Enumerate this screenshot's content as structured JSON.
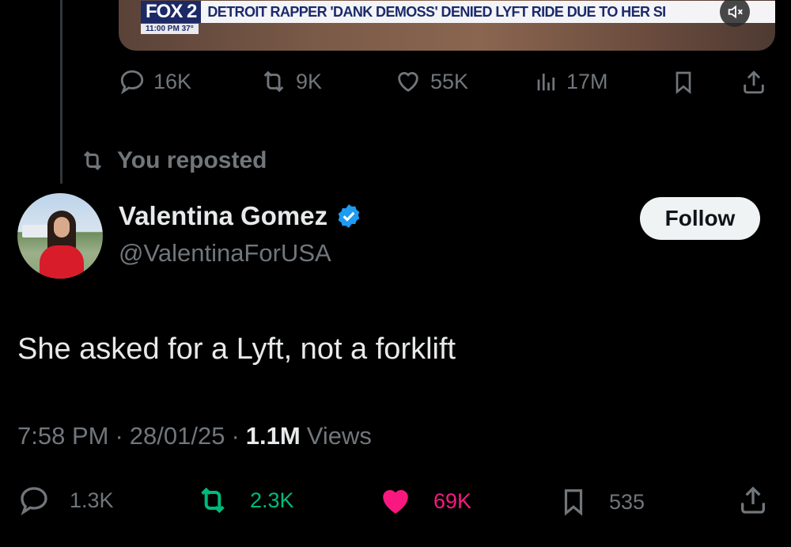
{
  "media": {
    "channel_logo": "FOX 2",
    "headline": "DETROIT RAPPER 'DANK DEMOSS' DENIED LYFT RIDE DUE TO HER SI",
    "time_temp": "11:00 PM  37°",
    "mute_icon": "speaker-muted-icon"
  },
  "previous_tweet": {
    "replies": "16K",
    "reposts": "9K",
    "likes": "55K",
    "views": "17M"
  },
  "repost_banner": "You reposted",
  "author": {
    "display_name": "Valentina Gomez",
    "handle": "@ValentinaForUSA",
    "verified": true,
    "verified_color": "#1d9bf0"
  },
  "follow_label": "Follow",
  "tweet": {
    "text": "She asked for a Lyft, not a forklift",
    "time": "7:58 PM",
    "date": "28/01/25",
    "views_count": "1.1M",
    "views_label": "Views"
  },
  "actions": {
    "replies": "1.3K",
    "reposts": "2.3K",
    "likes": "69K",
    "bookmarks": "535"
  },
  "colors": {
    "background": "#000000",
    "text": "#e7e9ea",
    "muted": "#71767b",
    "like": "#f91880",
    "repost": "#00ba7c"
  }
}
